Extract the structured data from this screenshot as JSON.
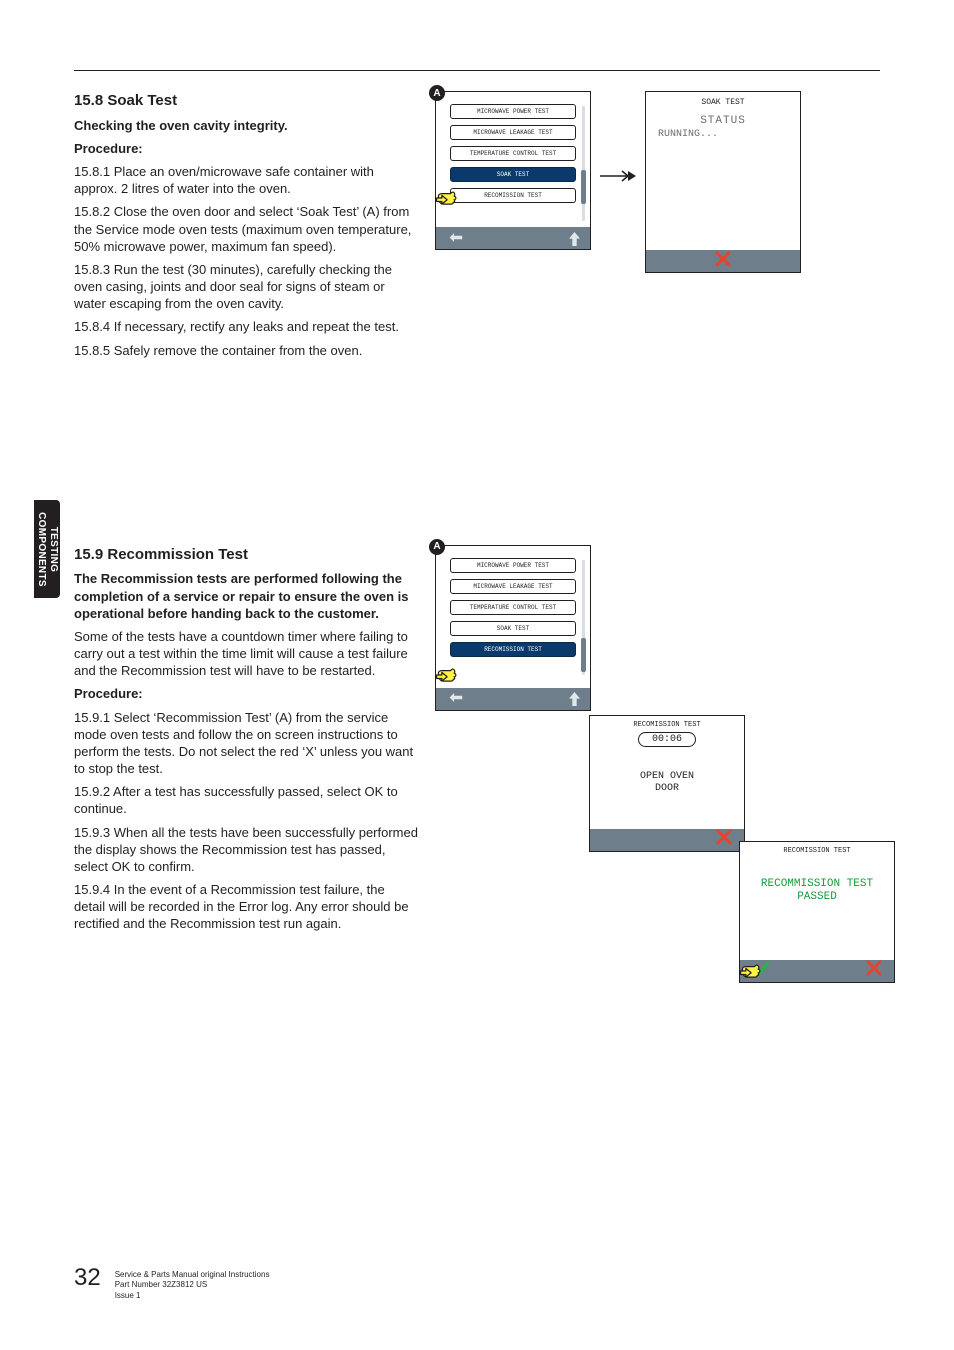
{
  "side_tab": {
    "line1": "TESTING",
    "line2": "COMPONENTS"
  },
  "sec1": {
    "heading": "15.8  Soak Test",
    "subhead": "Checking the oven cavity integrity.",
    "procedure_label": "Procedure:",
    "p1": "15.8.1  Place an oven/microwave safe container with approx. 2 litres of water into the oven.",
    "p2": "15.8.2  Close the oven door and select ‘Soak Test’ (A) from the Service mode oven tests  (maximum oven temperature, 50% microwave power, maximum fan speed).",
    "p3": "15.8.3  Run the test (30 minutes), carefully checking the oven casing, joints and door seal for signs of steam or water escaping from the oven cavity.",
    "p4": "15.8.4  If necessary, rectify any leaks and repeat the test.",
    "p5": "15.8.5  Safely remove the container from the oven."
  },
  "fig1": {
    "marker": "A",
    "menu": {
      "opt1": "MICROWAVE POWER TEST",
      "opt2": "MICROWAVE LEAKAGE TEST",
      "opt3": "TEMPERATURE CONTROL TEST",
      "opt4": "SOAK TEST",
      "opt5": "RECOMISSION TEST"
    },
    "status_screen": {
      "title": "SOAK TEST",
      "status_label": "STATUS",
      "status_value": "RUNNING..."
    }
  },
  "sec2": {
    "heading": "15.9  Recommission Test",
    "subhead": "The Recommission tests are performed following the completion of a service or repair to ensure the oven is operational before handing back to the customer.",
    "p_intro": "Some of the tests have a countdown timer where failing to carry out a test within the time limit will cause a test failure and the Recommission test will have to be restarted.",
    "procedure_label": "Procedure:",
    "p1": "15.9.1  Select ‘Recommission Test’ (A) from the service mode oven tests and follow the on screen instructions to perform the tests. Do not select the red ‘X’ unless you want to stop the test.",
    "p2": "15.9.2  After a test has successfully passed, select OK to continue.",
    "p3": "15.9.3  When all the tests have been successfully performed the display shows the Recommission test has passed, select OK to confirm.",
    "p4": "15.9.4  In the event of a Recommission test failure, the detail will be recorded in the Error log. Any error should be rectified and the Recommission test run again."
  },
  "fig2": {
    "marker": "A",
    "menu": {
      "opt1": "MICROWAVE POWER TEST",
      "opt2": "MICROWAVE LEAKAGE TEST",
      "opt3": "TEMPERATURE CONTROL TEST",
      "opt4": "SOAK TEST",
      "opt5": "RECOMISSION TEST"
    },
    "timer_screen": {
      "title": "RECOMISSION TEST",
      "time": "00:06",
      "msg_l1": "OPEN OVEN",
      "msg_l2": "DOOR"
    },
    "passed_screen": {
      "title": "RECOMISSION TEST",
      "msg_l1": "RECOMMISSION TEST",
      "msg_l2": "PASSED"
    }
  },
  "footer": {
    "page": "32",
    "l1": "Service & Parts Manual original Instructions",
    "l2": "Part Number 32Z3812 US",
    "l3": "Issue 1"
  }
}
